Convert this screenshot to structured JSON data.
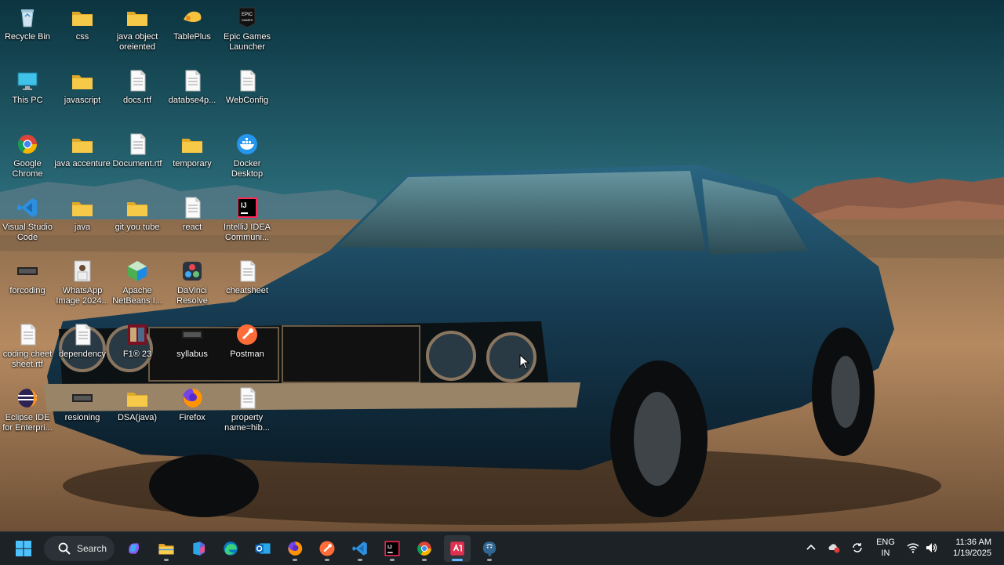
{
  "desktop": {
    "icons": [
      {
        "label": "Recycle Bin",
        "icon": "recycle-bin-icon"
      },
      {
        "label": "css",
        "icon": "folder-icon"
      },
      {
        "label": "java object oreiented",
        "icon": "folder-icon"
      },
      {
        "label": "TablePlus",
        "icon": "tableplus-icon"
      },
      {
        "label": "Epic Games Launcher",
        "icon": "epic-games-icon"
      },
      {
        "label": "This PC",
        "icon": "monitor-icon"
      },
      {
        "label": "javascript",
        "icon": "folder-icon"
      },
      {
        "label": "docs.rtf",
        "icon": "document-icon"
      },
      {
        "label": "databse4p...",
        "icon": "document-icon"
      },
      {
        "label": "WebConfig",
        "icon": "document-icon"
      },
      {
        "label": "Google Chrome",
        "icon": "chrome-icon"
      },
      {
        "label": "java accenture",
        "icon": "folder-icon"
      },
      {
        "label": "Document.rtf",
        "icon": "document-icon"
      },
      {
        "label": "temporary",
        "icon": "folder-icon"
      },
      {
        "label": "Docker Desktop",
        "icon": "docker-icon"
      },
      {
        "label": "Visual Studio Code",
        "icon": "vscode-icon"
      },
      {
        "label": "java",
        "icon": "folder-icon"
      },
      {
        "label": "git you tube",
        "icon": "folder-icon"
      },
      {
        "label": "react",
        "icon": "document-icon"
      },
      {
        "label": "IntelliJ IDEA Communi...",
        "icon": "intellij-icon"
      },
      {
        "label": "forcoding",
        "icon": "image-file-icon"
      },
      {
        "label": "WhatsApp Image 2024...",
        "icon": "photo-icon"
      },
      {
        "label": "Apache NetBeans I...",
        "icon": "netbeans-icon"
      },
      {
        "label": "DaVinci Resolve",
        "icon": "davinci-resolve-icon"
      },
      {
        "label": "cheatsheet",
        "icon": "document-icon"
      },
      {
        "label": "coding cheet sheet.rtf",
        "icon": "document-icon"
      },
      {
        "label": "dependency",
        "icon": "document-icon"
      },
      {
        "label": "F1® 23",
        "icon": "f1-game-icon"
      },
      {
        "label": "syllabus",
        "icon": "image-file-icon"
      },
      {
        "label": "Postman",
        "icon": "postman-icon"
      },
      {
        "label": "Eclipse IDE for Enterpri...",
        "icon": "eclipse-icon"
      },
      {
        "label": "resioning",
        "icon": "image-file-icon"
      },
      {
        "label": "DSA(java)",
        "icon": "folder-icon"
      },
      {
        "label": "Firefox",
        "icon": "firefox-icon"
      },
      {
        "label": "property name=hib...",
        "icon": "document-icon"
      }
    ]
  },
  "taskbar": {
    "search_label": "Search",
    "apps": [
      {
        "name": "copilot-icon"
      },
      {
        "name": "file-explorer-icon"
      },
      {
        "name": "microsoft-365-icon"
      },
      {
        "name": "edge-icon"
      },
      {
        "name": "outlook-icon"
      },
      {
        "name": "firefox-icon"
      },
      {
        "name": "postman-icon"
      },
      {
        "name": "vscode-icon"
      },
      {
        "name": "intellij-icon"
      },
      {
        "name": "chrome-icon"
      },
      {
        "name": "screen-recorder-icon"
      },
      {
        "name": "postgresql-icon"
      }
    ],
    "tray": {
      "lang_top": "ENG",
      "lang_bottom": "IN",
      "time": "11:36 AM",
      "date": "1/19/2025"
    }
  },
  "colors": {
    "taskbar_bg": "#1d2226",
    "sky_top": "#0e3b45",
    "sand": "#b98a5e",
    "car_body": "#1b3f55",
    "folder": "#f5c542",
    "accent": "#63b7ff"
  }
}
